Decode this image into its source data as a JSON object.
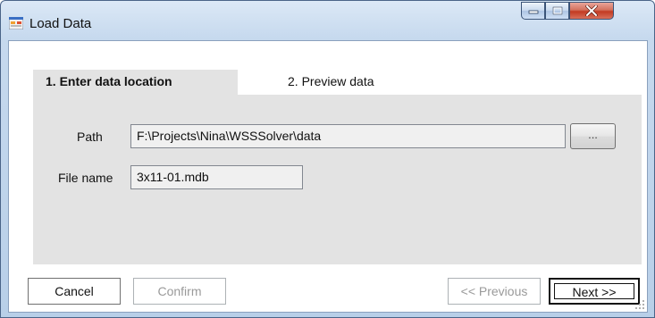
{
  "window": {
    "title": "Load Data"
  },
  "tabs": [
    {
      "label": "1. Enter data location"
    },
    {
      "label": "2. Preview data"
    }
  ],
  "form": {
    "path_label": "Path",
    "path_value": "F:\\Projects\\Nina\\WSSSolver\\data",
    "browse_label": "...",
    "file_name_label": "File name",
    "file_name_value": "3x11-01.mdb"
  },
  "buttons": {
    "cancel": "Cancel",
    "confirm": "Confirm",
    "previous": "<< Previous",
    "next": "Next >>"
  }
}
